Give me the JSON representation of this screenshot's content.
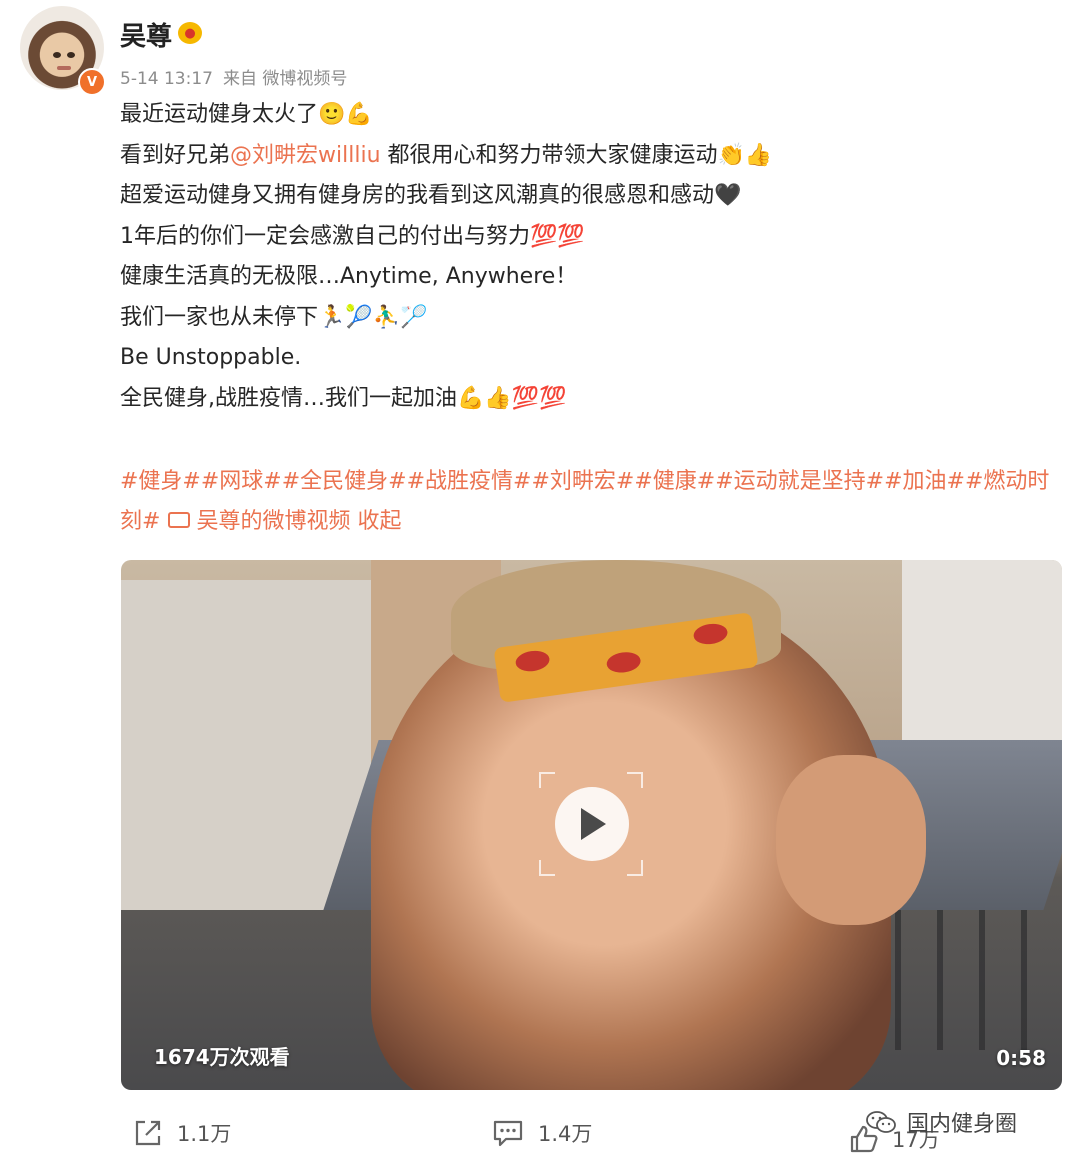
{
  "post": {
    "author": "吴尊",
    "avatar_badge": "V",
    "time": "5-14 13:17",
    "source": "来自 微博视频号",
    "lines": [
      "最近运动健身太火了🙂💪",
      "看到好兄弟",
      "超爱运动健身又拥有健身房的我看到这风潮真的很感恩和感动🖤",
      "1年后的你们一定会感激自己的付出与努力💯💯",
      "健康生活真的无极限…Anytime, Anywhere！",
      "我们一家也从未停下🏃🎾⛹️‍♂️🏸",
      "Be Unstoppable.",
      "全民健身,战胜疫情…我们一起加油💪👍💯💯"
    ],
    "mention": "@刘畊宏willliu",
    "line2_rest": " 都很用心和努力带领大家健康运动👏👍",
    "tags": "#健身##网球##全民健身##战胜疫情##刘畊宏##健康##运动就是坚持##加油##燃动时刻#",
    "video_link": "吴尊的微博视频",
    "collapse": "收起"
  },
  "video": {
    "views": "1674万次观看",
    "duration": "0:58"
  },
  "actions": {
    "share_count": "1.1万",
    "comment_count": "1.4万",
    "like_count": "17万"
  },
  "watermark": "国内健身圈",
  "colors": {
    "accent": "#eb7350",
    "badge": "#f0702a"
  }
}
